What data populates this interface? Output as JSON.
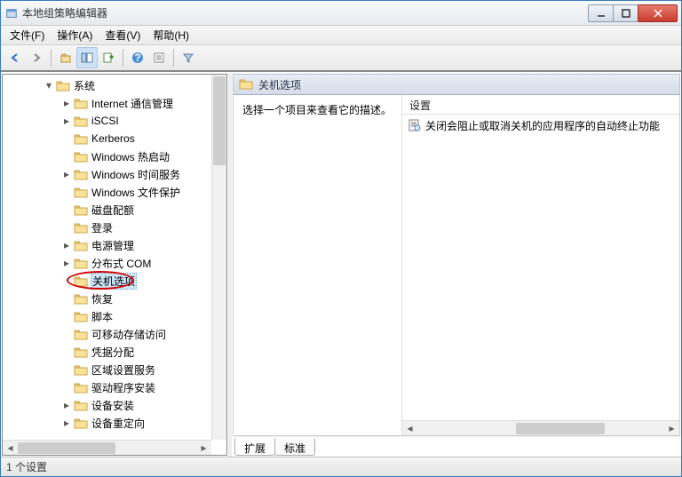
{
  "window": {
    "title": "本地组策略编辑器"
  },
  "menu": {
    "file": "文件(F)",
    "action": "操作(A)",
    "view": "查看(V)",
    "help": "帮助(H)"
  },
  "tree": {
    "root": "系统",
    "items": [
      {
        "label": "Internet 通信管理",
        "expandable": true
      },
      {
        "label": "iSCSI",
        "expandable": true
      },
      {
        "label": "Kerberos",
        "expandable": false
      },
      {
        "label": "Windows 热启动",
        "expandable": false
      },
      {
        "label": "Windows 时间服务",
        "expandable": true
      },
      {
        "label": "Windows 文件保护",
        "expandable": false
      },
      {
        "label": "磁盘配额",
        "expandable": false
      },
      {
        "label": "登录",
        "expandable": false
      },
      {
        "label": "电源管理",
        "expandable": true
      },
      {
        "label": "分布式 COM",
        "expandable": true
      },
      {
        "label": "关机选项",
        "expandable": false,
        "selected": true,
        "circled": true
      },
      {
        "label": "恢复",
        "expandable": false
      },
      {
        "label": "脚本",
        "expandable": false
      },
      {
        "label": "可移动存储访问",
        "expandable": false
      },
      {
        "label": "凭据分配",
        "expandable": false
      },
      {
        "label": "区域设置服务",
        "expandable": false
      },
      {
        "label": "驱动程序安装",
        "expandable": false
      },
      {
        "label": "设备安装",
        "expandable": true
      },
      {
        "label": "设备重定向",
        "expandable": true
      }
    ]
  },
  "panel": {
    "header": "关机选项",
    "prompt": "选择一个项目来查看它的描述。",
    "column": "设置",
    "settings": [
      "关闭会阻止或取消关机的应用程序的自动终止功能"
    ]
  },
  "tabs": {
    "extended": "扩展",
    "standard": "标准"
  },
  "status": "1 个设置"
}
